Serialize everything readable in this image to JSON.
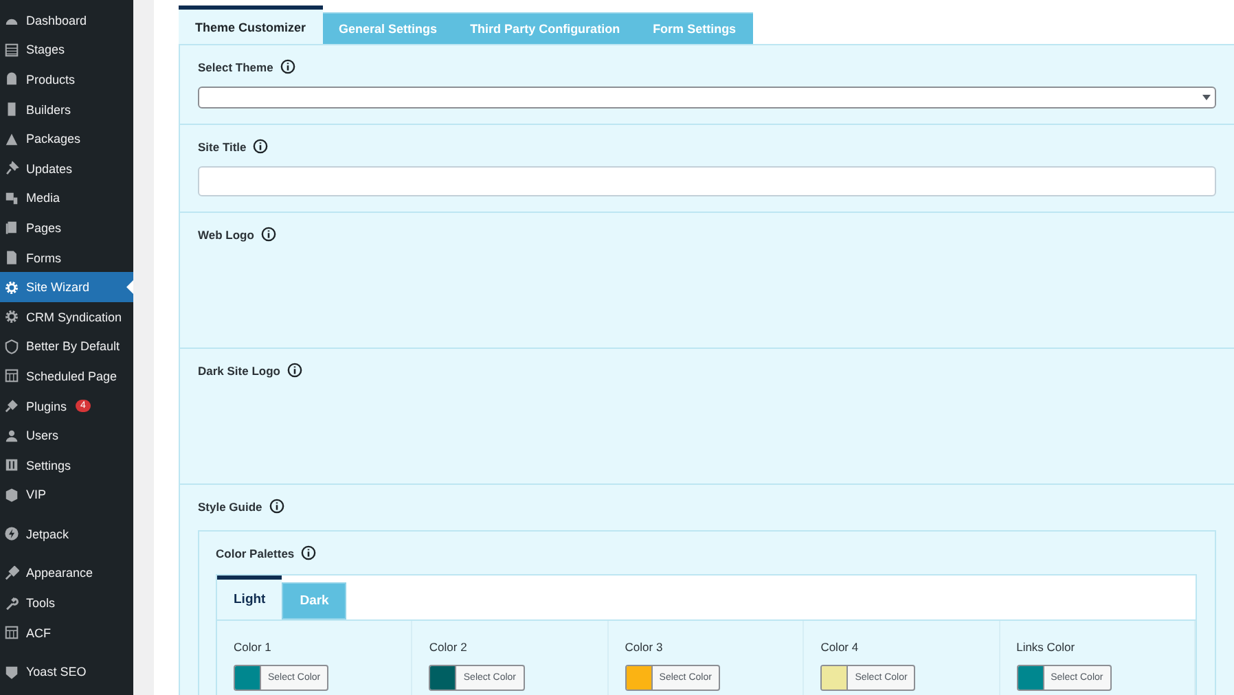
{
  "sidebar": {
    "items": [
      {
        "label": "Dashboard",
        "selected": false
      },
      {
        "label": "Stages",
        "selected": false
      },
      {
        "label": "Products",
        "selected": false
      },
      {
        "label": "Builders",
        "selected": false
      },
      {
        "label": "Packages",
        "selected": false
      },
      {
        "label": "Updates",
        "selected": false
      },
      {
        "label": "Media",
        "selected": false
      },
      {
        "label": "Pages",
        "selected": false
      },
      {
        "label": "Forms",
        "selected": false
      },
      {
        "label": "Site Wizard",
        "selected": true
      },
      {
        "label": "CRM Syndication",
        "selected": false
      },
      {
        "label": "Better By Default",
        "selected": false
      },
      {
        "label": "Scheduled Page",
        "selected": false
      },
      {
        "label": "Plugins",
        "selected": false,
        "badge": "4"
      },
      {
        "label": "Users",
        "selected": false
      },
      {
        "label": "Settings",
        "selected": false
      },
      {
        "label": "VIP",
        "selected": false
      },
      {
        "label": "Jetpack",
        "selected": false,
        "gap": true
      },
      {
        "label": "Appearance",
        "selected": false,
        "gap": true
      },
      {
        "label": "Tools",
        "selected": false
      },
      {
        "label": "ACF",
        "selected": false
      },
      {
        "label": "Yoast SEO",
        "selected": false,
        "gap": true
      }
    ]
  },
  "tabs": [
    {
      "label": "Theme Customizer",
      "selected": true
    },
    {
      "label": "General Settings",
      "selected": false
    },
    {
      "label": "Third Party Configuration",
      "selected": false
    },
    {
      "label": "Form Settings",
      "selected": false
    }
  ],
  "sections": [
    {
      "label": "Select Theme",
      "kind": "select"
    },
    {
      "label": "Site Title",
      "kind": "text"
    },
    {
      "label": "Web Logo",
      "kind": "empty"
    },
    {
      "label": "Dark Site Logo",
      "kind": "empty"
    },
    {
      "label": "Style Guide",
      "kind": "palettes"
    }
  ],
  "color_palettes": {
    "label": "Color Palettes",
    "tabs": [
      {
        "label": "Light",
        "selected": true
      },
      {
        "label": "Dark",
        "selected": false
      }
    ],
    "colors": [
      {
        "label": "Color 1",
        "color": "#00878f",
        "button": "Select Color"
      },
      {
        "label": "Color 2",
        "color": "#005f62",
        "button": "Select Color"
      },
      {
        "label": "Color 3",
        "color": "#fbb313",
        "button": "Select Color"
      },
      {
        "label": "Color 4",
        "color": "#eee89d",
        "button": "Select Color"
      },
      {
        "label": "Links Color",
        "color": "#00878f",
        "button": "Select Color"
      }
    ]
  }
}
